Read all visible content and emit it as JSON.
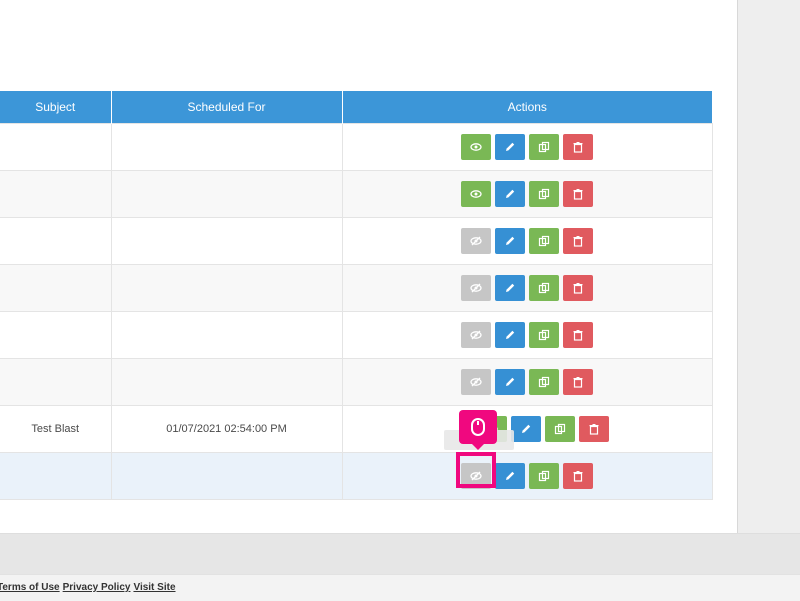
{
  "table": {
    "headers": {
      "subject": "Subject",
      "scheduled_for": "Scheduled For",
      "actions": "Actions"
    },
    "rows": [
      {
        "subject": "",
        "scheduled_for": "",
        "view_state": "enabled"
      },
      {
        "subject": "",
        "scheduled_for": "",
        "view_state": "enabled"
      },
      {
        "subject": "",
        "scheduled_for": "",
        "view_state": "disabled"
      },
      {
        "subject": "",
        "scheduled_for": "",
        "view_state": "disabled"
      },
      {
        "subject": "",
        "scheduled_for": "",
        "view_state": "disabled"
      },
      {
        "subject": "",
        "scheduled_for": "",
        "view_state": "disabled"
      },
      {
        "subject": "Test Blast",
        "scheduled_for": "01/07/2021 02:54:00 PM",
        "view_state": "enabled"
      },
      {
        "subject": "",
        "scheduled_for": "",
        "view_state": "disabled"
      }
    ]
  },
  "icons": {
    "view": "eye-icon",
    "view_disabled": "eye-slash-icon",
    "edit": "pencil-icon",
    "copy": "copy-icon",
    "delete": "trash-icon",
    "cursor": "mouse-icon"
  },
  "footer": {
    "terms": "Terms of Use",
    "privacy": "Privacy Policy",
    "visit": "Visit Site"
  },
  "colors": {
    "header": "#3c96d8",
    "view": "#7ab855",
    "edit": "#3690d4",
    "delete": "#e05a5f",
    "disabled": "#c6c6c6",
    "highlight": "#f0087f"
  }
}
